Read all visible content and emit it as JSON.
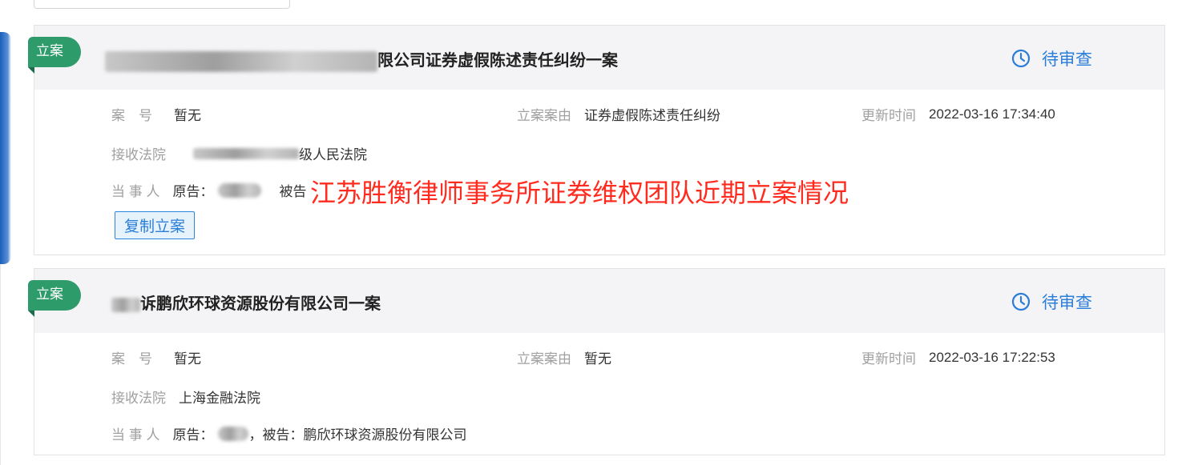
{
  "cards": [
    {
      "tag": "立案",
      "title_visible": "限公司证券虚假陈述责任纠纷一案",
      "status": "待审查",
      "case_no_label": "案　号",
      "case_no_value": "暂无",
      "cause_label": "立案案由",
      "cause_value": "证券虚假陈述责任纠纷",
      "updated_label": "更新时间",
      "updated_value": "2022-03-16 17:34:40",
      "court_label": "接收法院",
      "court_value_visible": "级人民法院",
      "parties_label": "当 事 人",
      "plaintiff_prefix": "原告：",
      "defendant_prefix": "被告",
      "copy_button": "复制立案"
    },
    {
      "tag": "立案",
      "title_visible": "诉鹏欣环球资源股份有限公司一案",
      "status": "待审查",
      "case_no_label": "案　号",
      "case_no_value": "暂无",
      "cause_label": "立案案由",
      "cause_value": "暂无",
      "updated_label": "更新时间",
      "updated_value": "2022-03-16 17:22:53",
      "court_label": "接收法院",
      "court_value": "上海金融法院",
      "parties_label": "当 事 人",
      "plaintiff_prefix": "原告：",
      "defendant_text": "，被告：鹏欣环球资源股份有限公司"
    }
  ],
  "watermark": "江苏胜衡律师事务所证券维权团队近期立案情况",
  "colors": {
    "tag": "#2e9b6a",
    "status": "#2a7dd8",
    "watermark": "#ff2b1f"
  }
}
